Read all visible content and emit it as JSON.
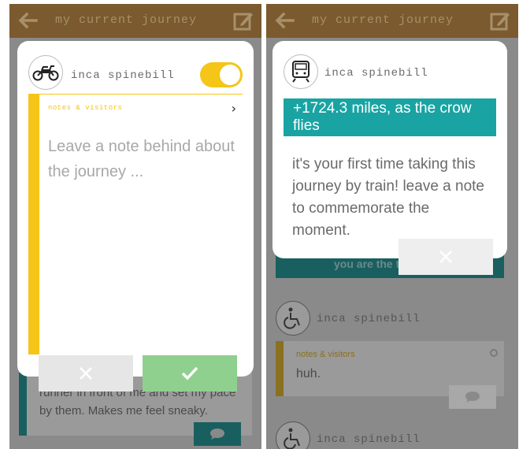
{
  "left_screen": {
    "header": {
      "title": "my current journey"
    },
    "modal": {
      "username": "inca spinebill",
      "toggle_on": true,
      "notes_label": "notes & visitors",
      "placeholder": "Leave a note behind about the journey ..."
    },
    "background": {
      "text_line_1": "runner in front of me and set my pace",
      "text_line_2": "by them.  Makes me feel sneaky."
    }
  },
  "right_screen": {
    "header": {
      "title": "my current journey"
    },
    "modal": {
      "username": "inca spinebill",
      "miles": "+1724.3 miles, as the crow flies",
      "message": "it's your first time taking this journey by train! leave a note to commemorate the moment."
    },
    "background": {
      "banner_text": "you are the t",
      "user_1": "inca spinebill",
      "notes_label": "notes & visitors",
      "note_text": "huh.",
      "user_2": "inca spinebill"
    }
  },
  "colors": {
    "header_brown": "#7a5a2e",
    "accent_yellow": "#f5c518",
    "teal": "#1aa3a3",
    "confirm_green": "#8fd08f"
  },
  "icons": [
    "back-arrow-icon",
    "edit-icon",
    "motorcycle-icon",
    "train-icon",
    "wheelchair-icon",
    "chevron-right-icon",
    "close-icon",
    "check-icon",
    "chat-bubble-icon",
    "gear-icon"
  ]
}
